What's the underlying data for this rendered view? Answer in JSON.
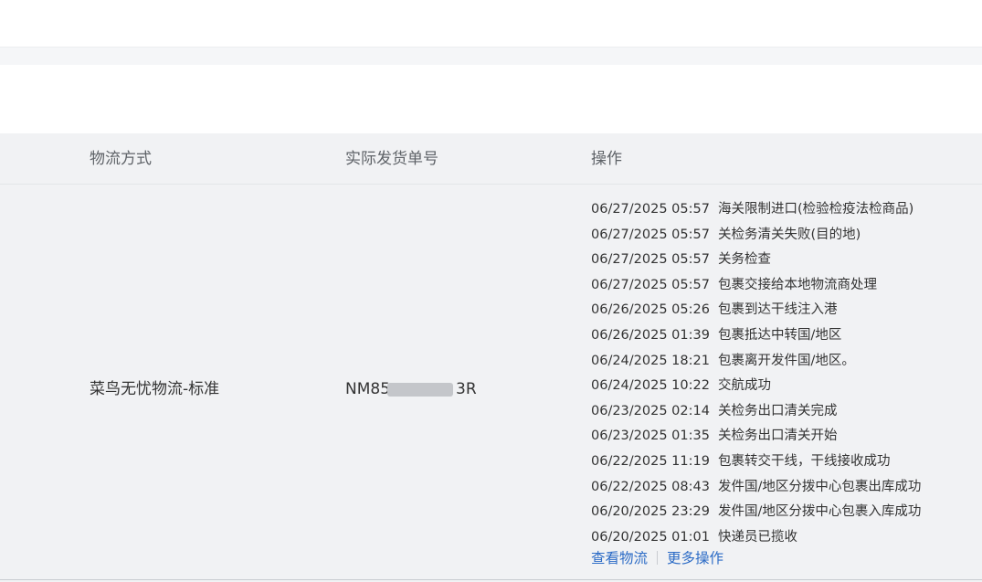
{
  "table": {
    "headers": {
      "method": "物流方式",
      "tracking": "实际发货单号",
      "operations": "操作"
    },
    "row": {
      "method": "菜鸟无忧物流-标准",
      "tracking_prefix": "NM85",
      "tracking_suffix": "3R",
      "events": [
        {
          "time": "06/27/2025 05:57",
          "text": "海关限制进口(检验检疫法检商品)"
        },
        {
          "time": "06/27/2025 05:57",
          "text": "关检务清关失败(目的地)"
        },
        {
          "time": "06/27/2025 05:57",
          "text": "关务检查"
        },
        {
          "time": "06/27/2025 05:57",
          "text": "包裹交接给本地物流商处理"
        },
        {
          "time": "06/26/2025 05:26",
          "text": "包裹到达干线注入港"
        },
        {
          "time": "06/26/2025 01:39",
          "text": "包裹抵达中转国/地区"
        },
        {
          "time": "06/24/2025 18:21",
          "text": "包裹离开发件国/地区。"
        },
        {
          "time": "06/24/2025 10:22",
          "text": "交航成功"
        },
        {
          "time": "06/23/2025 02:14",
          "text": "关检务出口清关完成"
        },
        {
          "time": "06/23/2025 01:35",
          "text": "关检务出口清关开始"
        },
        {
          "time": "06/22/2025 11:19",
          "text": "包裹转交干线，干线接收成功"
        },
        {
          "time": "06/22/2025 08:43",
          "text": "发件国/地区分拨中心包裹出库成功"
        },
        {
          "time": "06/20/2025 23:29",
          "text": "发件国/地区分拨中心包裹入库成功"
        },
        {
          "time": "06/20/2025 01:01",
          "text": "快递员已揽收"
        }
      ],
      "actions": {
        "view_logistics": "查看物流",
        "more_actions": "更多操作"
      }
    }
  }
}
